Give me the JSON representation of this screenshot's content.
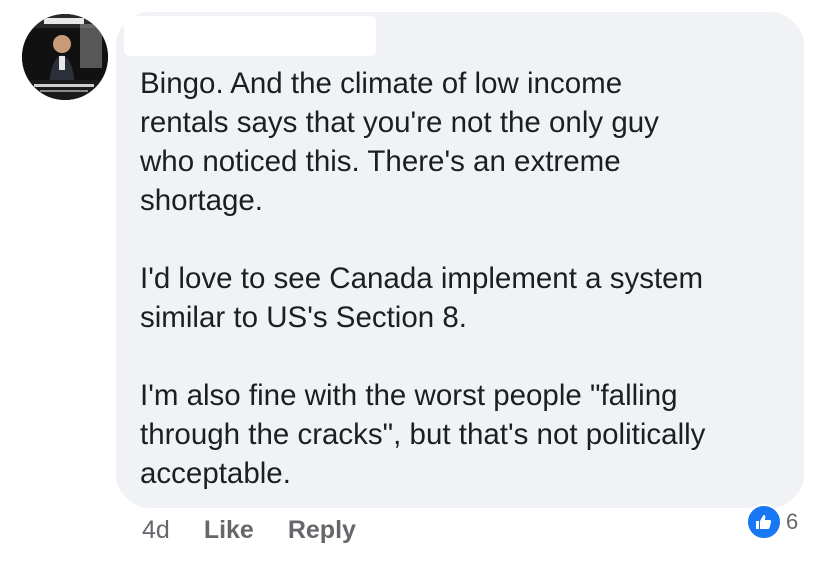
{
  "comment": {
    "paragraphs": [
      "Bingo. And the climate of low income\nrentals says that you're not the only guy\nwho noticed this. There's an extreme\nshortage.",
      "I'd love to see Canada implement a system\nsimilar to US's Section 8.",
      "I'm also fine with the worst people \"falling\nthrough the cracks\", but that's not politically\nacceptable."
    ]
  },
  "footer": {
    "timestamp": "4d",
    "like_label": "Like",
    "reply_label": "Reply"
  },
  "reactions": {
    "icon": "thumbs-up-icon",
    "count": "6",
    "color": "#1877f2"
  },
  "colors": {
    "bubble": "#f0f2f5",
    "text": "#1c1e21",
    "muted": "#65676b"
  }
}
